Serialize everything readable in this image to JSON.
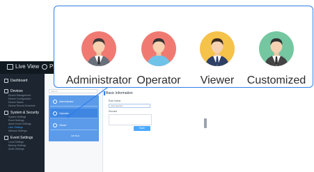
{
  "topbar": {
    "live_view": "Live View",
    "playback": "Pl"
  },
  "sidenav": {
    "groups": [
      {
        "label": "Dashboard"
      },
      {
        "label": "Devices",
        "items": [
          "Device Management",
          "Device Configuration",
          "Device Status",
          "Device Record Schedule"
        ]
      },
      {
        "label": "System & Security",
        "items": [
          "System Settings",
          "Event Settings",
          "Alarm Event Settings",
          "User Settings",
          "Network Settings"
        ]
      },
      {
        "label": "Event Settings",
        "items": [
          "Local Settings",
          "Backup Settings",
          "Audio Settings"
        ]
      }
    ],
    "active_item": "User Settings"
  },
  "list_panel": {
    "search_placeholder": "Search",
    "roles": [
      "Administrator",
      "Operator",
      "Viewer"
    ],
    "add_role": "Add Role"
  },
  "form": {
    "section_title": "Basic Information",
    "name_label": "Role Name",
    "name_value": "Administrator",
    "remark_label": "Remark",
    "save_label": "Save"
  },
  "callout": {
    "roles": [
      {
        "label": "Administrator",
        "icon": "administrator-avatar-icon",
        "bg": "#f07a72",
        "shirt": "#ffffff",
        "tie": "#333333",
        "jacket": "#666f7a",
        "hair": "#3a3a3a"
      },
      {
        "label": "Operator",
        "icon": "operator-avatar-icon",
        "bg": "#f07a72",
        "shirt": "#6fc2e8",
        "tie": "#6fc2e8",
        "jacket": "#6fc2e8",
        "hair": "#333333"
      },
      {
        "label": "Viewer",
        "icon": "viewer-avatar-icon",
        "bg": "#f5c24a",
        "shirt": "#ffffff",
        "tie": "#2e3f66",
        "jacket": "#2e3f66",
        "hair": "#3a2c22"
      },
      {
        "label": "Customized",
        "icon": "customized-avatar-icon",
        "bg": "#74c7a0",
        "shirt": "#ffffff",
        "tie": "#333333",
        "jacket": "#444444",
        "hair": "#333333"
      }
    ],
    "border_color": "#2f7fe6"
  }
}
